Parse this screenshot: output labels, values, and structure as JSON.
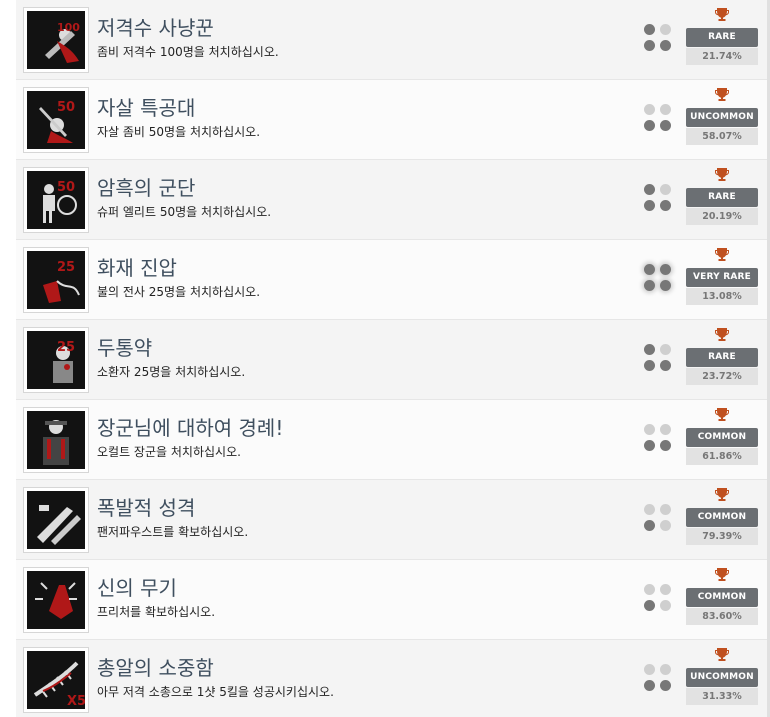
{
  "achievements": [
    {
      "title": "저격수 사냥꾼",
      "desc": "좀비 저격수 100명을 처치하십시오.",
      "rarity": "RARE",
      "percent": "21.74%",
      "icon": "sniper-zombie-icon",
      "thumb_text": "100",
      "dots": [
        1,
        0,
        1,
        1
      ]
    },
    {
      "title": "자살 특공대",
      "desc": "자살 좀비 50명을 처치하십시오.",
      "rarity": "UNCOMMON",
      "percent": "58.07%",
      "icon": "suicide-zombie-icon",
      "thumb_text": "50",
      "dots": [
        0,
        0,
        1,
        1
      ]
    },
    {
      "title": "암흑의 군단",
      "desc": "슈퍼 엘리트 50명을 처치하십시오.",
      "rarity": "RARE",
      "percent": "20.19%",
      "icon": "elite-soldier-icon",
      "thumb_text": "50",
      "dots": [
        1,
        0,
        1,
        1
      ]
    },
    {
      "title": "화재 진압",
      "desc": "불의 전사 25명을 처치하십시오.",
      "rarity": "VERY RARE",
      "percent": "13.08%",
      "icon": "fire-warrior-icon",
      "thumb_text": "25",
      "dots": [
        1,
        1,
        1,
        1
      ]
    },
    {
      "title": "두통약",
      "desc": "소환자 25명을 처치하십시오.",
      "rarity": "RARE",
      "percent": "23.72%",
      "icon": "summoner-icon",
      "thumb_text": "25",
      "dots": [
        1,
        0,
        1,
        1
      ]
    },
    {
      "title": "장군님에 대하여 경례!",
      "desc": "오컬트 장군을 처치하십시오.",
      "rarity": "COMMON",
      "percent": "61.86%",
      "icon": "occult-general-icon",
      "thumb_text": "",
      "dots": [
        0,
        0,
        1,
        1
      ]
    },
    {
      "title": "폭발적 성격",
      "desc": "팬저파우스트를 확보하십시오.",
      "rarity": "COMMON",
      "percent": "79.39%",
      "icon": "panzerfaust-icon",
      "thumb_text": "",
      "dots": [
        0,
        0,
        1,
        0
      ]
    },
    {
      "title": "신의 무기",
      "desc": "프리처를 확보하십시오.",
      "rarity": "COMMON",
      "percent": "83.60%",
      "icon": "preacher-weapon-icon",
      "thumb_text": "",
      "dots": [
        0,
        0,
        1,
        0
      ]
    },
    {
      "title": "총알의 소중함",
      "desc": "아무 저격 소총으로 1샷 5킬을 성공시키십시오.",
      "rarity": "UNCOMMON",
      "percent": "31.33%",
      "icon": "bullet-spine-icon",
      "thumb_text": "X5",
      "dots": [
        0,
        0,
        1,
        1
      ]
    }
  ],
  "colors": {
    "trophy": "#c0501f",
    "rarity_bg": "#6b6f73",
    "title": "#3f4f5f",
    "accent_red": "#b01818"
  }
}
